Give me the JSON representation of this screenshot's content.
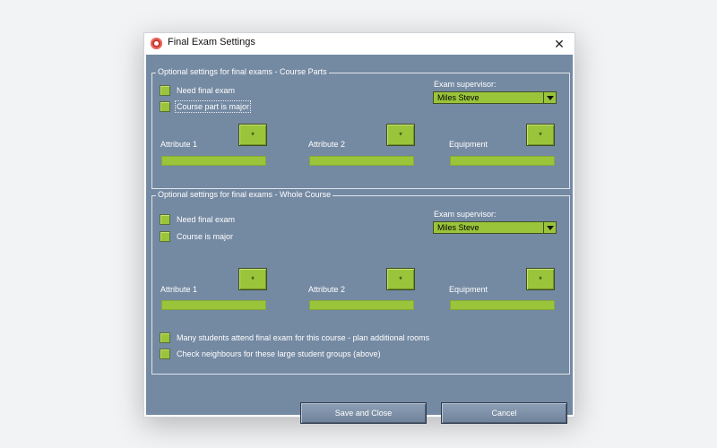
{
  "window": {
    "title": "Final Exam Settings"
  },
  "parts": {
    "label": "Optional settings for final exams - Course Parts",
    "need_final_exam": "Need final exam",
    "course_part_major": "Course part is major",
    "supervisor_label": "Exam supervisor:",
    "supervisor_value": "Miles Steve",
    "attr1": "Attribute 1",
    "attr2": "Attribute 2",
    "equipment": "Equipment",
    "pick_glyph": "*"
  },
  "whole": {
    "label": "Optional settings for final exams - Whole Course",
    "need_final_exam": "Need final exam",
    "course_major": "Course is major",
    "supervisor_label": "Exam supervisor:",
    "supervisor_value": "Miles Steve",
    "attr1": "Attribute 1",
    "attr2": "Attribute 2",
    "equipment": "Equipment",
    "pick_glyph": "*",
    "many_students": "Many students attend final exam for this course - plan additional rooms",
    "check_neighbours": "Check neighbours for these large student groups (above)"
  },
  "buttons": {
    "save": "Save and Close",
    "cancel": "Cancel"
  },
  "icons": {
    "app": "app-logo-icon",
    "close": "close-icon",
    "dropdown": "chevron-down-icon"
  }
}
